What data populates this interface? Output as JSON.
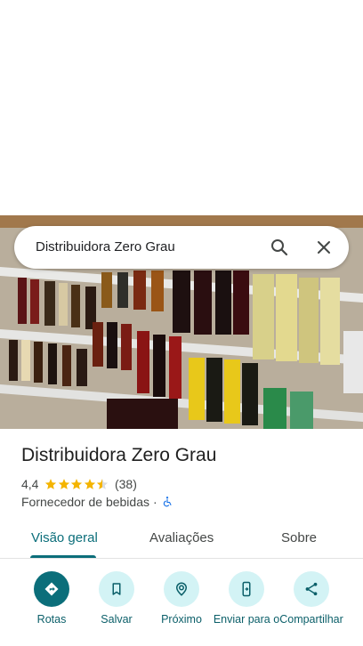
{
  "search": {
    "query": "Distribuidora Zero Grau"
  },
  "place": {
    "name": "Distribuidora Zero Grau",
    "rating": "4,4",
    "stars": 4.4,
    "review_count": "(38)",
    "category": "Fornecedor de bebidas",
    "separator": "·"
  },
  "tabs": [
    {
      "label": "Visão geral",
      "active": true
    },
    {
      "label": "Avaliações",
      "active": false
    },
    {
      "label": "Sobre",
      "active": false
    }
  ],
  "actions": [
    {
      "label": "Rotas",
      "icon": "directions-icon"
    },
    {
      "label": "Salvar",
      "icon": "bookmark-icon"
    },
    {
      "label": "Próximo",
      "icon": "nearby-icon"
    },
    {
      "label": "Enviar para o",
      "icon": "send-to-phone-icon"
    },
    {
      "label": "Compartilhar",
      "icon": "share-icon"
    }
  ],
  "colors": {
    "accent": "#0b6e7a",
    "action_bg": "#d3f3f5",
    "star": "#f4b400"
  }
}
